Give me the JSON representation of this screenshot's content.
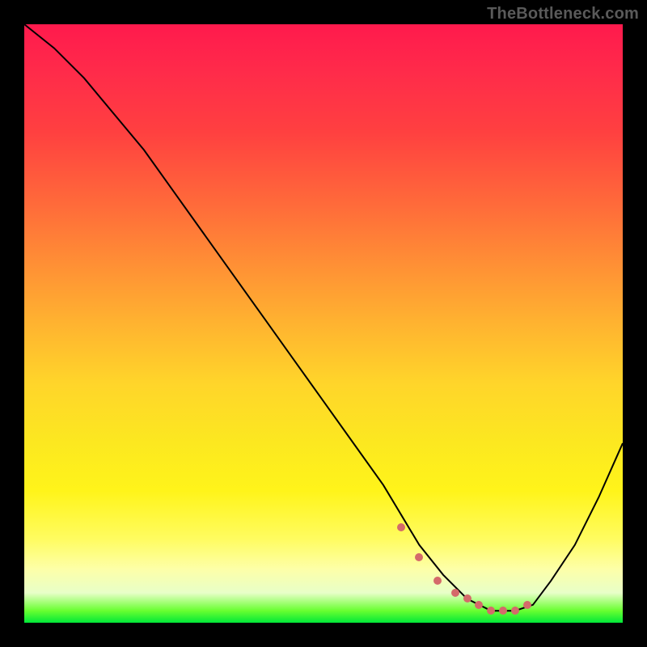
{
  "watermark": "TheBottleneck.com",
  "chart_data": {
    "type": "line",
    "title": "",
    "xlabel": "",
    "ylabel": "",
    "xlim": [
      0,
      100
    ],
    "ylim": [
      0,
      100
    ],
    "grid": false,
    "legend": false,
    "series": [
      {
        "name": "bottleneck-curve",
        "color": "#000000",
        "x": [
          0,
          5,
          10,
          15,
          20,
          25,
          30,
          35,
          40,
          45,
          50,
          55,
          60,
          63,
          66,
          70,
          74,
          78,
          82,
          85,
          88,
          92,
          96,
          100
        ],
        "y": [
          100,
          96,
          91,
          85,
          79,
          72,
          65,
          58,
          51,
          44,
          37,
          30,
          23,
          18,
          13,
          8,
          4,
          2,
          2,
          3,
          7,
          13,
          21,
          30
        ]
      }
    ],
    "scatter": {
      "name": "highlight-dots",
      "color": "#d46a6a",
      "x": [
        63,
        66,
        69,
        72,
        74,
        76,
        78,
        80,
        82,
        84
      ],
      "y": [
        16,
        11,
        7,
        5,
        4,
        3,
        2,
        2,
        2,
        3
      ]
    }
  }
}
